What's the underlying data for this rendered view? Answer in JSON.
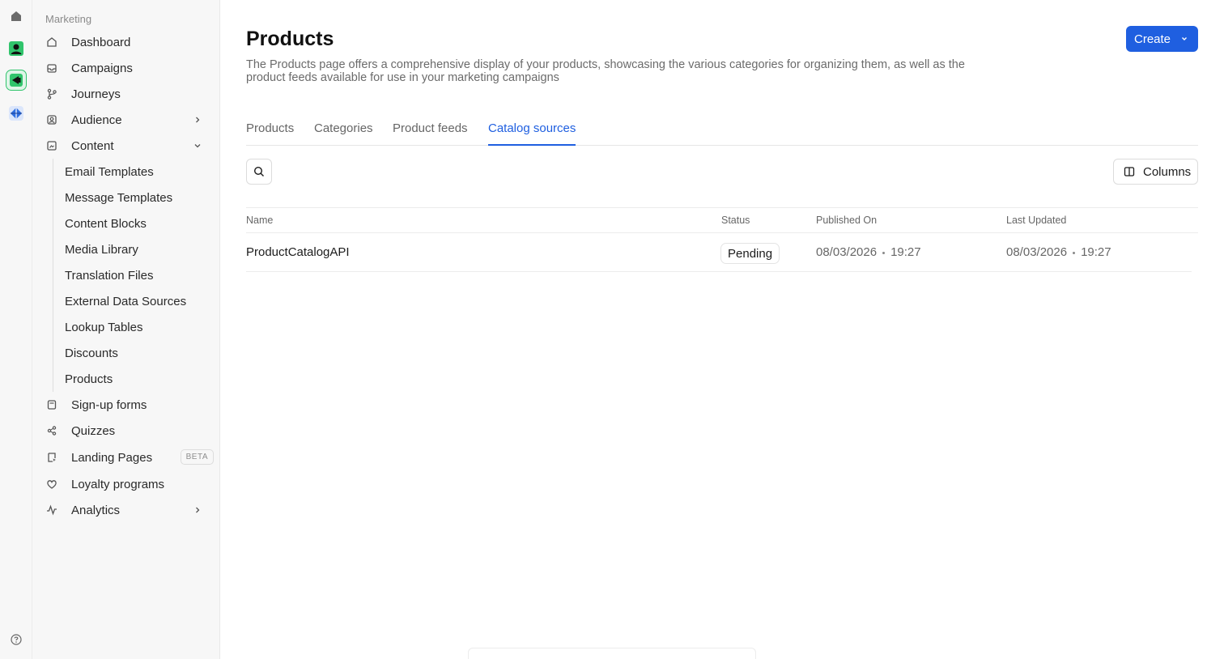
{
  "sidebar": {
    "section_label": "Marketing",
    "items": [
      {
        "label": "Dashboard",
        "icon": "home-icon"
      },
      {
        "label": "Campaigns",
        "icon": "inbox-icon"
      },
      {
        "label": "Journeys",
        "icon": "branch-icon"
      },
      {
        "label": "Audience",
        "icon": "audience-icon"
      },
      {
        "label": "Content",
        "icon": "content-icon"
      },
      {
        "label": "Sign-up forms",
        "icon": "form-icon"
      },
      {
        "label": "Quizzes",
        "icon": "quiz-icon"
      },
      {
        "label": "Landing Pages",
        "icon": "landing-page-icon",
        "badge": "BETA"
      },
      {
        "label": "Loyalty programs",
        "icon": "heart-icon"
      },
      {
        "label": "Analytics",
        "icon": "activity-icon"
      }
    ],
    "content_subitems": [
      "Email Templates",
      "Message Templates",
      "Content Blocks",
      "Media Library",
      "Translation Files",
      "External Data Sources",
      "Lookup Tables",
      "Discounts",
      "Products"
    ]
  },
  "header": {
    "title": "Products",
    "description": "The Products page offers a comprehensive display of your products, showcasing the various categories for organizing them, as well as the product feeds available for use in your marketing campaigns",
    "create_label": "Create"
  },
  "tabs": [
    {
      "label": "Products"
    },
    {
      "label": "Categories"
    },
    {
      "label": "Product feeds"
    },
    {
      "label": "Catalog sources",
      "active": true
    }
  ],
  "toolbar": {
    "columns_label": "Columns"
  },
  "table": {
    "columns": [
      "Name",
      "Status",
      "Published On",
      "Last Updated"
    ],
    "rows": [
      {
        "name": "ProductCatalogAPI",
        "status": "Pending",
        "published_date": "08/03/2026",
        "published_time": "19:27",
        "updated_date": "08/03/2026",
        "updated_time": "19:27"
      }
    ]
  },
  "colors": {
    "accent": "#1f5fe0",
    "sidebar_bg": "#f7f7f7",
    "brand_green": "#2fbf71"
  }
}
